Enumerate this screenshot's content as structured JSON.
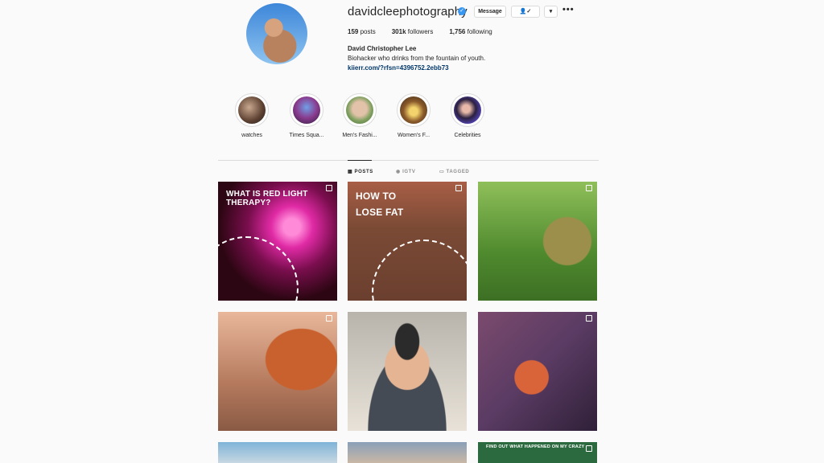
{
  "profile": {
    "username": "davidcleephotography",
    "verified_icon": "verified-badge-icon",
    "message_label": "Message",
    "following_icon": "person-check-icon",
    "dropdown_icon": "chevron-down-icon",
    "more_icon": "more-options-icon",
    "posts_count": "159",
    "posts_label": "posts",
    "followers_count": "301k",
    "followers_label": "followers",
    "following_count": "1,756",
    "following_label": "following",
    "full_name": "David Christopher Lee",
    "bio": "Biohacker who drinks from the fountain of youth.",
    "link": "kiierr.com/?rfsn=4396752.2ebb73"
  },
  "highlights": [
    {
      "label": "watches"
    },
    {
      "label": "Times Squa..."
    },
    {
      "label": "Men's Fashi..."
    },
    {
      "label": "Women's F..."
    },
    {
      "label": "Celebrities"
    }
  ],
  "tabs": [
    {
      "label": "POSTS",
      "active": true
    },
    {
      "label": "IGTV",
      "active": false
    },
    {
      "label": "TAGGED",
      "active": false
    }
  ],
  "posts": [
    {
      "overlay": "WHAT IS RED LIGHT THERAPY?"
    },
    {
      "overlay_line1": "HOW TO",
      "overlay_line2": "LOSE FAT"
    },
    {
      "overlay": ""
    },
    {
      "overlay": ""
    },
    {
      "overlay": ""
    },
    {
      "overlay": ""
    },
    {
      "overlay": ""
    },
    {
      "overlay": ""
    },
    {
      "overlay": "FIND OUT WHAT HAPPENED ON MY CRAZY"
    }
  ],
  "colors": {
    "accent": "#3897f0",
    "link": "#00376b",
    "border": "#dbdbdb"
  }
}
